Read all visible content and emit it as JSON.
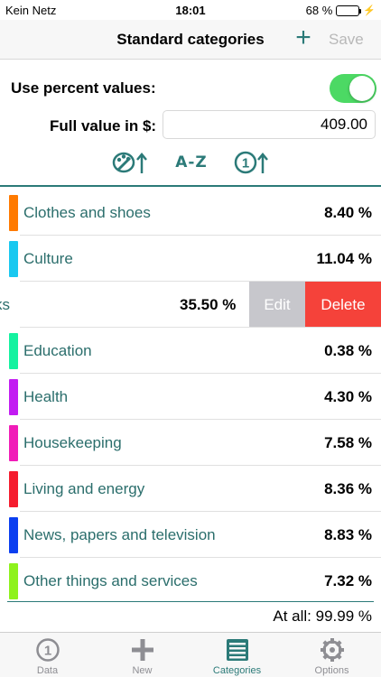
{
  "status_bar": {
    "carrier": "Kein Netz",
    "time": "18:01",
    "battery": "68 %",
    "battery_level": 0.68
  },
  "nav": {
    "title": "Standard categories",
    "add_label": "+",
    "save_label": "Save"
  },
  "settings": {
    "percent_label": "Use percent values:",
    "percent_enabled": true,
    "full_value_label": "Full value in $:",
    "full_value": "409.00"
  },
  "sort_bar": {
    "az_label": "A-Z",
    "icons": [
      "color-sort-icon",
      "number-sort-icon"
    ]
  },
  "colors": {
    "accent": "#2b7a78",
    "toggle_on": "#4cd964",
    "delete": "#f5423a",
    "edit": "#c7c7cc"
  },
  "categories": [
    {
      "name": "Clothes and shoes",
      "value": "8.40 %",
      "color": "#ff7a00"
    },
    {
      "name": "Culture",
      "value": "11.04 %",
      "color": "#19c8f0"
    },
    {
      "name": "ks",
      "value": "35.50 %",
      "color": "#ffffff",
      "swiped": true,
      "edit_label": "Edit",
      "delete_label": "Delete"
    },
    {
      "name": "Education",
      "value": "0.38 %",
      "color": "#14f2a0"
    },
    {
      "name": "Health",
      "value": "4.30 %",
      "color": "#c21cf2"
    },
    {
      "name": "Housekeeping",
      "value": "7.58 %",
      "color": "#f01cb8"
    },
    {
      "name": "Living and energy",
      "value": "8.36 %",
      "color": "#f51c2e"
    },
    {
      "name": "News, papers and television",
      "value": "8.83 %",
      "color": "#0b3ff0"
    },
    {
      "name": "Other things and services",
      "value": "7.32 %",
      "color": "#8ef21c"
    }
  ],
  "total": "At all: 99.99 %",
  "tabs": [
    {
      "label": "Data",
      "icon": "number-one-icon",
      "active": false
    },
    {
      "label": "New",
      "icon": "plus-icon",
      "active": false
    },
    {
      "label": "Categories",
      "icon": "categories-icon",
      "active": true
    },
    {
      "label": "Options",
      "icon": "gear-icon",
      "active": false
    }
  ]
}
